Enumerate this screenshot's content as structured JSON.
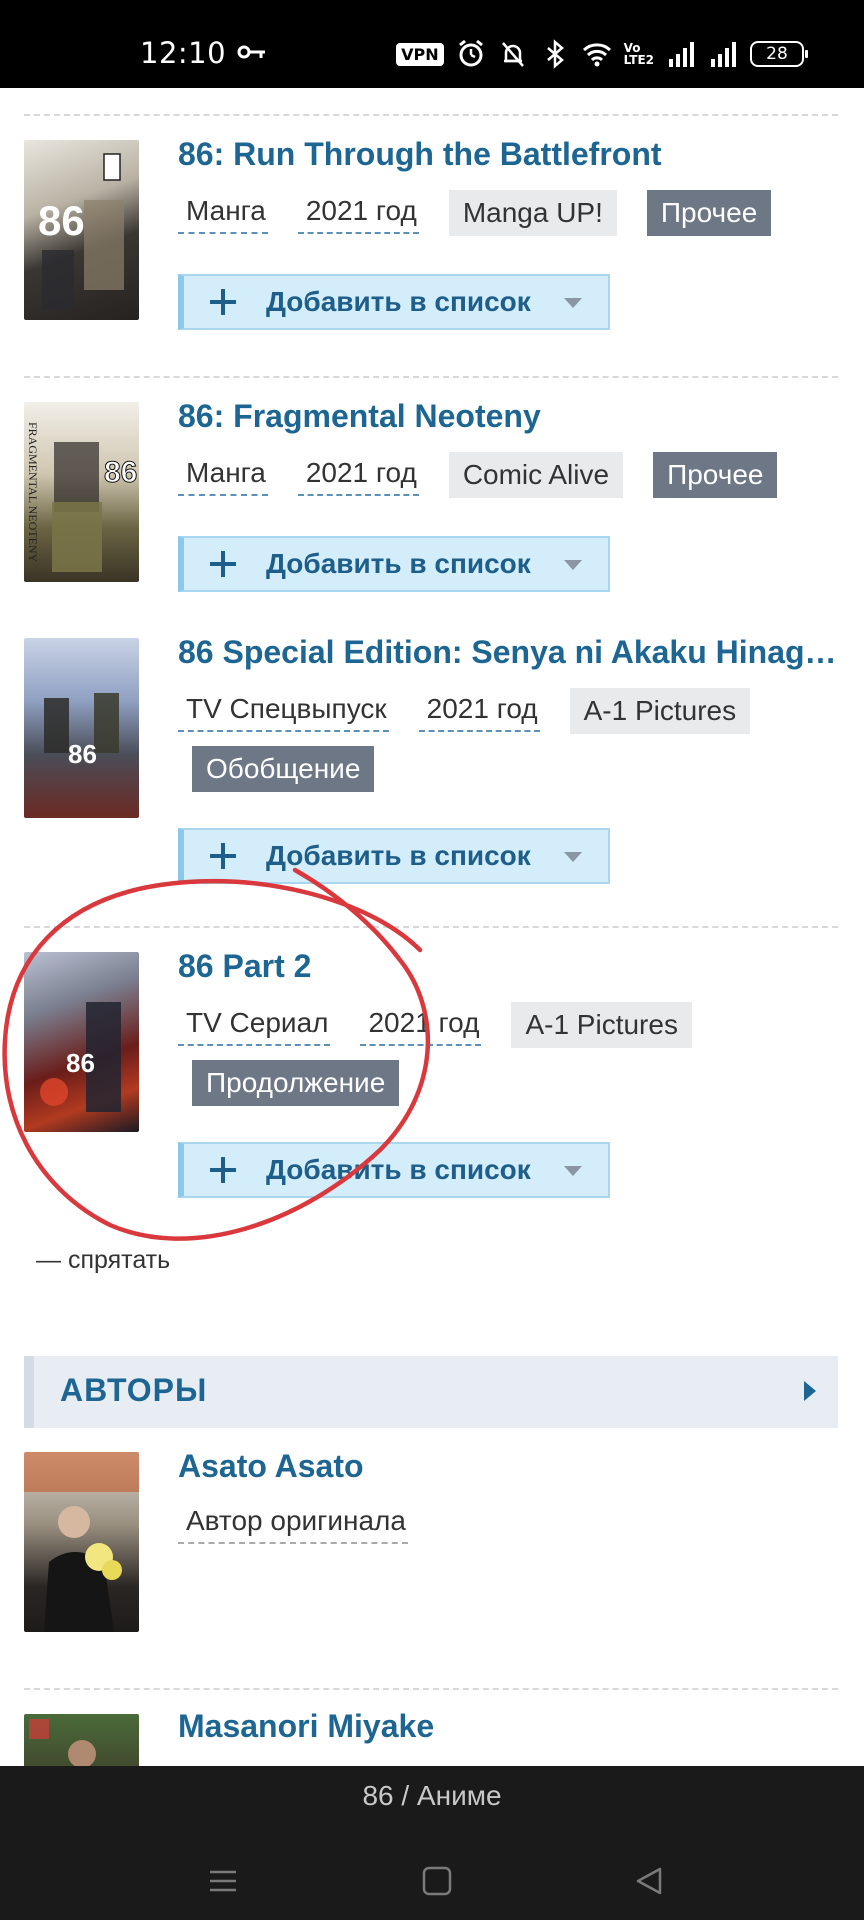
{
  "status_bar": {
    "time": "12:10",
    "vpn": "VPN",
    "volte_top": "Vo",
    "volte_bottom": "LTE2",
    "battery": "28"
  },
  "related": [
    {
      "title": "86: Run Through the Battlefront",
      "type": "Манга",
      "year": "2021 год",
      "studio": "Manga UP!",
      "relation": "Прочее",
      "add_label": "Добавить в список"
    },
    {
      "title": "86: Fragmental Neoteny",
      "type": "Манга",
      "year": "2021 год",
      "studio": "Comic Alive",
      "relation": "Прочее",
      "add_label": "Добавить в список"
    },
    {
      "title": "86 Special Edition: Senya ni Akaku Hinag…",
      "type": "TV Спецвыпуск",
      "year": "2021 год",
      "studio": "A-1 Pictures",
      "relation": "Обобщение",
      "add_label": "Добавить в список"
    },
    {
      "title": "86 Part 2",
      "type": "TV Сериал",
      "year": "2021 год",
      "studio": "A-1 Pictures",
      "relation": "Продолжение",
      "add_label": "Добавить в список"
    }
  ],
  "hide_link": "— спрятать",
  "authors_section": {
    "title": "АВТОРЫ",
    "authors": [
      {
        "name": "Asato Asato",
        "role": "Автор оригинала"
      },
      {
        "name": "Masanori Miyake"
      }
    ]
  },
  "bottom_bar": {
    "page_title": "86 / Аниме"
  },
  "colors": {
    "link": "#1d6693",
    "tag_bg": "#6e7786",
    "studio_bg": "#e9eaec",
    "add_button_bg": "#d4edfb",
    "annotation": "#d9393c"
  }
}
